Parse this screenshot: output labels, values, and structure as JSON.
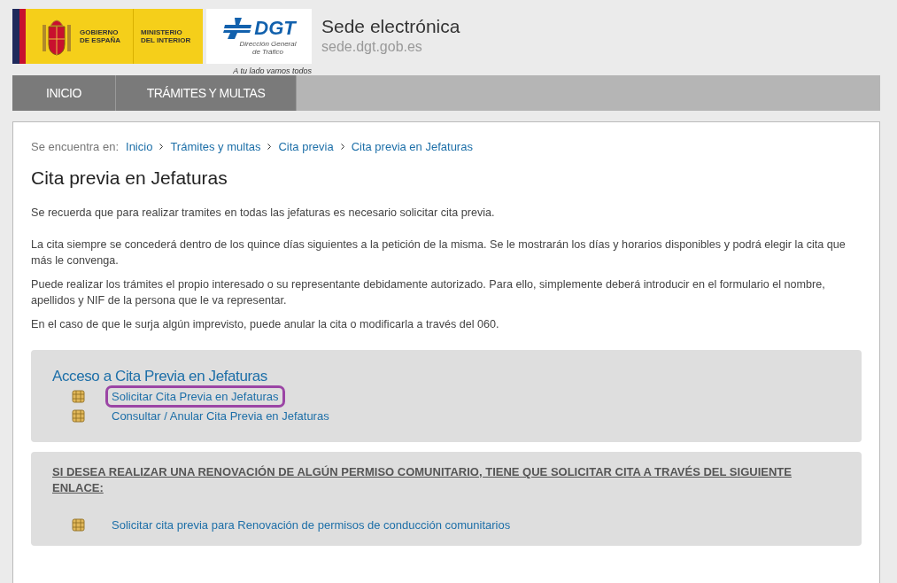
{
  "header": {
    "gov_logo": {
      "line1": "GOBIERNO",
      "line2": "DE ESPAÑA",
      "ministry1": "MINISTERIO",
      "ministry2": "DEL INTERIOR"
    },
    "dgt_logo": {
      "name": "DGT",
      "sub1": "Dirección General",
      "sub2": "de Tráfico",
      "slogan": "A tu lado vamos todos"
    },
    "site_title": "Sede electrónica",
    "site_url": "sede.dgt.gob.es"
  },
  "nav": [
    "INICIO",
    "TRÁMITES Y MULTAS"
  ],
  "breadcrumb": {
    "label": "Se encuentra en:",
    "items": [
      "Inicio",
      "Trámites y multas",
      "Cita previa",
      "Cita previa en Jefaturas"
    ]
  },
  "page_title": "Cita previa en Jefaturas",
  "paragraphs": [
    "Se recuerda que para realizar tramites en todas las jefaturas es necesario solicitar cita previa.",
    "La cita siempre se concederá dentro de los quince días siguientes a la petición de la misma. Se le mostrarán los días y horarios disponibles y podrá elegir la cita que más le convenga.",
    "Puede realizar los trámites el propio interesado o su representante debidamente autorizado. Para ello, simplemente deberá introducir en el formulario el nombre, apellidos y NIF de la persona que le va representar.",
    "En el caso de que le surja algún imprevisto, puede anular la cita o modificarla a través del 060."
  ],
  "access_box": {
    "title": "Acceso a Cita Previa en Jefaturas",
    "links": [
      {
        "label": "Solicitar Cita Previa en Jefaturas",
        "highlighted": true
      },
      {
        "label": "Consultar / Anular Cita Previa en Jefaturas",
        "highlighted": false
      }
    ]
  },
  "renewal_box": {
    "notice": "SI DESEA REALIZAR UNA RENOVACIÓN DE ALGÚN PERMISO COMUNITARIO, TIENE QUE SOLICITAR CITA A TRAVÉS DEL SIGUIENTE ENLACE:",
    "links": [
      {
        "label": "Solicitar cita previa para Renovación de permisos de conducción comunitarios",
        "highlighted": false
      }
    ]
  }
}
